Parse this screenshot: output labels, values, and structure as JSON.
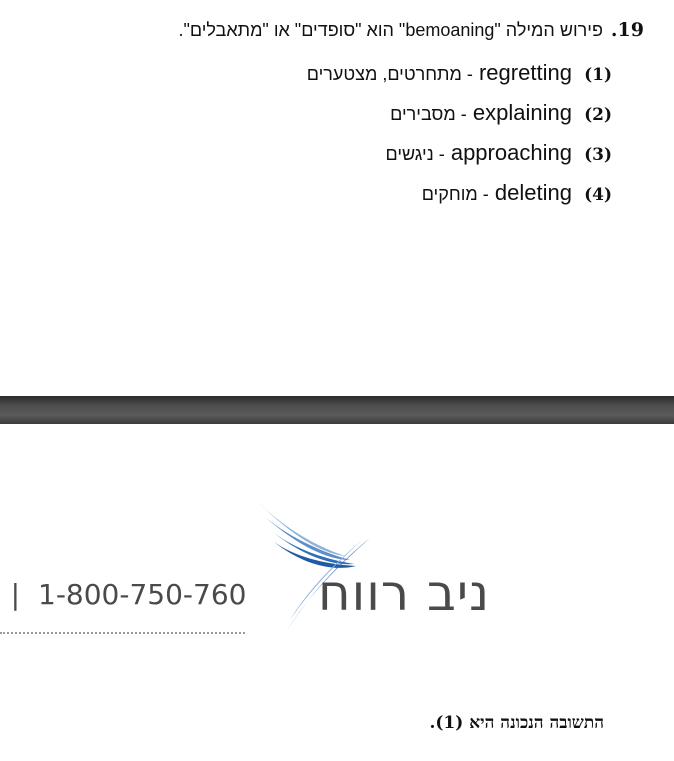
{
  "question": {
    "number": "19.",
    "text": "פירוש המילה \"bemoaning\" הוא \"סופדים\" או \"מתאבלים\".",
    "options": [
      {
        "num": "(1)",
        "english": "regretting",
        "hebrew": "- מתחרטים, מצטערים"
      },
      {
        "num": "(2)",
        "english": "explaining",
        "hebrew": "- מסבירים"
      },
      {
        "num": "(3)",
        "english": "approaching",
        "hebrew": "- ניגשים"
      },
      {
        "num": "(4)",
        "english": "deleting",
        "hebrew": "- מוחקים"
      }
    ]
  },
  "header": {
    "phone_prefix": "l |",
    "phone": "1-800-750-760",
    "logo_name": "ניב רווח",
    "colors": {
      "logo_blue": "#2f6fb8",
      "logo_light_blue": "#8fb3dd",
      "text_gray": "#4a4a4a"
    }
  },
  "answer": {
    "text": "התשובה הנכונה היא (1)."
  }
}
